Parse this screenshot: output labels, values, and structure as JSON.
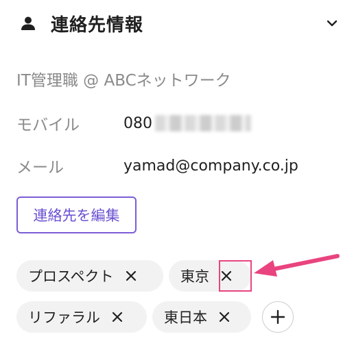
{
  "section": {
    "title": "連絡先情報",
    "icon": "person-icon",
    "toggle_icon": "chevron-down-icon"
  },
  "contact": {
    "job": "IT管理職 @ ABCネットワーク",
    "mobile_label": "モバイル",
    "mobile_value": "080",
    "email_label": "メール",
    "email_value": "yamad@company.co.jp"
  },
  "edit_button": {
    "label": "連絡先を編集"
  },
  "tags": [
    {
      "label": "プロスペクト",
      "remove": "✕"
    },
    {
      "label": "東京",
      "remove": "✕"
    },
    {
      "label": "リファラル",
      "remove": "✕"
    },
    {
      "label": "東日本",
      "remove": "✕"
    }
  ],
  "colors": {
    "accent": "#7b5cd6",
    "highlight": "#e9447f",
    "tag_bg": "#f2f2f2",
    "label_gray": "#8a8a8a"
  }
}
